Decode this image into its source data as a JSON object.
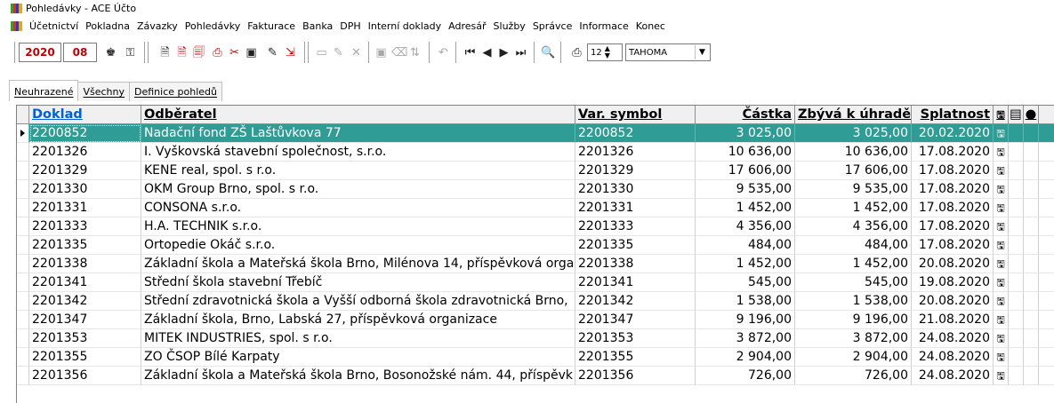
{
  "window": {
    "title": "Pohledávky - ACE Účto"
  },
  "menu": [
    "Účetnictví",
    "Pokladna",
    "Závazky",
    "Pohledávky",
    "Fakturace",
    "Banka",
    "DPH",
    "Interní doklady",
    "Adresář",
    "Služby",
    "Správce",
    "Informace",
    "Konec"
  ],
  "toolbar": {
    "year": "2020",
    "month": "08",
    "font_size": "12",
    "font_name": "TAHOMA"
  },
  "tabs": [
    "Neuhrazené",
    "Všechny",
    "Definice pohledů"
  ],
  "table": {
    "headers": {
      "doklad": "Doklad",
      "odberatel": "Odběratel",
      "var_symbol": "Var. symbol",
      "castka": "Částka",
      "zbyva": "Zbývá k úhradě",
      "splatnost": "Splatnost"
    },
    "rows": [
      {
        "doklad": "2200852",
        "odberatel": "Nadační fond ZŠ Laštůvkova 77",
        "var_symbol": "2200852",
        "castka": "3 025,00",
        "zbyva": "3 025,00",
        "splatnost": "20.02.2020"
      },
      {
        "doklad": "2201326",
        "odberatel": "I. Vyškovská stavební společnost, s.r.o.",
        "var_symbol": "2201326",
        "castka": "10 636,00",
        "zbyva": "10 636,00",
        "splatnost": "17.08.2020"
      },
      {
        "doklad": "2201329",
        "odberatel": "KENE real, spol. s r.o.",
        "var_symbol": "2201329",
        "castka": "17 606,00",
        "zbyva": "17 606,00",
        "splatnost": "17.08.2020"
      },
      {
        "doklad": "2201330",
        "odberatel": "OKM Group Brno, spol. s r.o.",
        "var_symbol": "2201330",
        "castka": "9 535,00",
        "zbyva": "9 535,00",
        "splatnost": "17.08.2020"
      },
      {
        "doklad": "2201331",
        "odberatel": "CONSONA s.r.o.",
        "var_symbol": "2201331",
        "castka": "1 452,00",
        "zbyva": "1 452,00",
        "splatnost": "17.08.2020"
      },
      {
        "doklad": "2201333",
        "odberatel": "H.A. TECHNIK s.r.o.",
        "var_symbol": "2201333",
        "castka": "4 356,00",
        "zbyva": "4 356,00",
        "splatnost": "17.08.2020"
      },
      {
        "doklad": "2201335",
        "odberatel": "Ortopedie Okáč s.r.o.",
        "var_symbol": "2201335",
        "castka": "484,00",
        "zbyva": "484,00",
        "splatnost": "17.08.2020"
      },
      {
        "doklad": "2201338",
        "odberatel": "Základní škola a Mateřská škola Brno, Milénova 14, příspěvková orga",
        "var_symbol": "2201338",
        "castka": "1 452,00",
        "zbyva": "1 452,00",
        "splatnost": "20.08.2020"
      },
      {
        "doklad": "2201341",
        "odberatel": "Střední škola stavební Třebíč",
        "var_symbol": "2201341",
        "castka": "545,00",
        "zbyva": "545,00",
        "splatnost": "19.08.2020"
      },
      {
        "doklad": "2201342",
        "odberatel": "Střední zdravotnická škola a Vyšší odborná škola zdravotnická Brno,",
        "var_symbol": "2201342",
        "castka": "1 538,00",
        "zbyva": "1 538,00",
        "splatnost": "20.08.2020"
      },
      {
        "doklad": "2201347",
        "odberatel": "Základní škola, Brno, Labská 27, příspěvková organizace",
        "var_symbol": "2201347",
        "castka": "9 196,00",
        "zbyva": "9 196,00",
        "splatnost": "21.08.2020"
      },
      {
        "doklad": "2201353",
        "odberatel": "MITEK INDUSTRIES, spol. s r.o.",
        "var_symbol": "2201353",
        "castka": "3 872,00",
        "zbyva": "3 872,00",
        "splatnost": "24.08.2020"
      },
      {
        "doklad": "2201355",
        "odberatel": "ZO ČSOP Bílé Karpaty",
        "var_symbol": "2201355",
        "castka": "2 904,00",
        "zbyva": "2 904,00",
        "splatnost": "24.08.2020"
      },
      {
        "doklad": "2201356",
        "odberatel": "Základní škola a Mateřská škola Brno, Bosonožské nám. 44, příspěvk",
        "var_symbol": "2201356",
        "castka": "726,00",
        "zbyva": "726,00",
        "splatnost": "24.08.2020"
      }
    ],
    "selected_row": 0
  },
  "colors": {
    "selection": "#2f9c96",
    "sorted_header": "#0060d8",
    "period": "#c00000"
  }
}
